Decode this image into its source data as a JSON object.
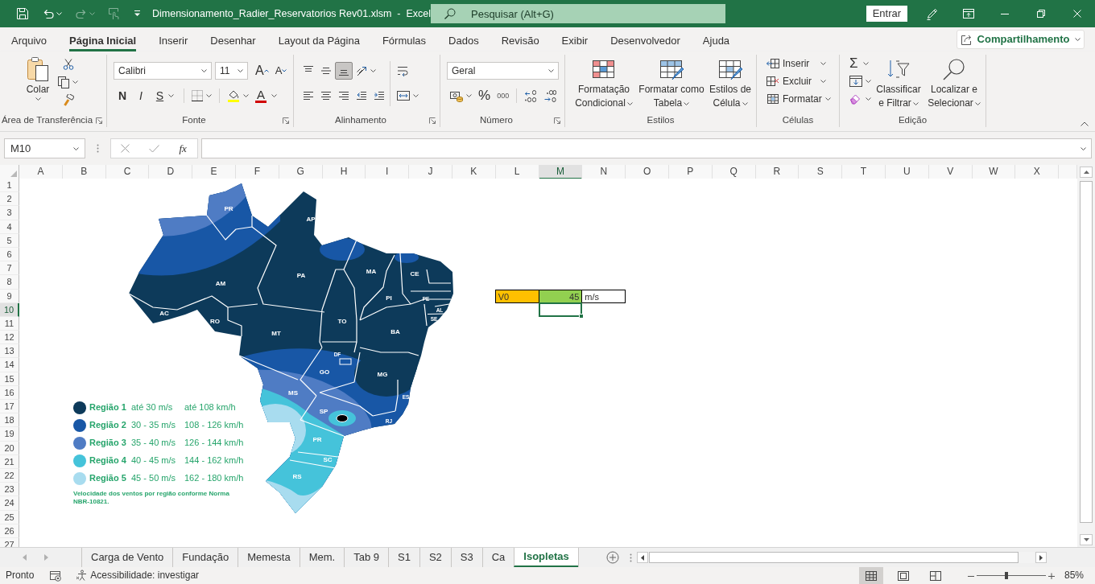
{
  "title_bar": {
    "title": "Dimensionamento_Radier_Reservatorios Rev01.xlsm  -  Excel",
    "search": {
      "placeholder": "Pesquisar (Alt+G)"
    },
    "sign_in": "Entrar"
  },
  "quick_access": [
    {
      "kind": "save",
      "disabled": false
    },
    {
      "kind": "undo",
      "disabled": false
    },
    {
      "kind": "redo",
      "disabled": true
    },
    {
      "kind": "touch",
      "disabled": true
    }
  ],
  "menu_tabs": [
    {
      "label": "Arquivo",
      "selected": false
    },
    {
      "label": "Página Inicial",
      "selected": true
    },
    {
      "label": "Inserir",
      "selected": false
    },
    {
      "label": "Desenhar",
      "selected": false
    },
    {
      "label": "Layout da Página",
      "selected": false
    },
    {
      "label": "Fórmulas",
      "selected": false
    },
    {
      "label": "Dados",
      "selected": false
    },
    {
      "label": "Revisão",
      "selected": false
    },
    {
      "label": "Exibir",
      "selected": false
    },
    {
      "label": "Desenvolvedor",
      "selected": false
    },
    {
      "label": "Ajuda",
      "selected": false
    }
  ],
  "share_button": "Compartilhamento",
  "ribbon": {
    "clipboard": {
      "label": "Área de Transferência",
      "paste": "Colar"
    },
    "font": {
      "label": "Fonte",
      "font_name": "Calibri",
      "font_size": "11",
      "grow": "A",
      "shrink": "A",
      "bold": "N",
      "italic": "I",
      "underline": "S",
      "font_color": "A"
    },
    "alignment": {
      "label": "Alinhamento",
      "vertical": [
        {
          "kind": "top",
          "selected": false
        },
        {
          "kind": "middle",
          "selected": false
        },
        {
          "kind": "bottom",
          "selected": true
        }
      ]
    },
    "number": {
      "label": "Número",
      "format": "Geral",
      "percent": "%",
      "thousands": "000"
    },
    "styles": {
      "label": "Estilos",
      "buttons": [
        {
          "kind": "conditional",
          "lines": [
            "Formatação",
            "Condicional"
          ]
        },
        {
          "kind": "table",
          "lines": [
            "Formatar como",
            "Tabela"
          ]
        },
        {
          "kind": "cell_styles",
          "lines": [
            "Estilos de",
            "Célula"
          ]
        }
      ]
    },
    "cells": {
      "label": "Células",
      "buttons": [
        {
          "kind": "insert",
          "label": "Inserir"
        },
        {
          "kind": "delete",
          "label": "Excluir"
        },
        {
          "kind": "format",
          "label": "Formatar"
        }
      ]
    },
    "editing": {
      "label": "Edição",
      "autosum": "Σ",
      "buttons": [
        {
          "kind": "sort",
          "lines": [
            "Classificar",
            "e Filtrar"
          ]
        },
        {
          "kind": "find",
          "lines": [
            "Localizar e",
            "Selecionar"
          ]
        }
      ]
    }
  },
  "formula_bar": {
    "name_box": "M10",
    "function_button": "fx"
  },
  "columns": [
    {
      "label": "A",
      "selected": false
    },
    {
      "label": "B",
      "selected": false
    },
    {
      "label": "C",
      "selected": false
    },
    {
      "label": "D",
      "selected": false
    },
    {
      "label": "E",
      "selected": false
    },
    {
      "label": "F",
      "selected": false
    },
    {
      "label": "G",
      "selected": false
    },
    {
      "label": "H",
      "selected": false
    },
    {
      "label": "I",
      "selected": false
    },
    {
      "label": "J",
      "selected": false
    },
    {
      "label": "K",
      "selected": false
    },
    {
      "label": "L",
      "selected": false
    },
    {
      "label": "M",
      "selected": true
    },
    {
      "label": "N",
      "selected": false
    },
    {
      "label": "O",
      "selected": false
    },
    {
      "label": "P",
      "selected": false
    },
    {
      "label": "Q",
      "selected": false
    },
    {
      "label": "R",
      "selected": false
    },
    {
      "label": "S",
      "selected": false
    },
    {
      "label": "T",
      "selected": false
    },
    {
      "label": "U",
      "selected": false
    },
    {
      "label": "V",
      "selected": false
    },
    {
      "label": "W",
      "selected": false
    },
    {
      "label": "X",
      "selected": false
    }
  ],
  "rows": [
    {
      "label": "1",
      "selected": false
    },
    {
      "label": "2",
      "selected": false
    },
    {
      "label": "3",
      "selected": false
    },
    {
      "label": "4",
      "selected": false
    },
    {
      "label": "5",
      "selected": false
    },
    {
      "label": "6",
      "selected": false
    },
    {
      "label": "7",
      "selected": false
    },
    {
      "label": "8",
      "selected": false
    },
    {
      "label": "9",
      "selected": false
    },
    {
      "label": "10",
      "selected": true
    },
    {
      "label": "11",
      "selected": false
    },
    {
      "label": "12",
      "selected": false
    },
    {
      "label": "13",
      "selected": false
    },
    {
      "label": "14",
      "selected": false
    },
    {
      "label": "15",
      "selected": false
    },
    {
      "label": "16",
      "selected": false
    },
    {
      "label": "17",
      "selected": false
    },
    {
      "label": "18",
      "selected": false
    },
    {
      "label": "19",
      "selected": false
    },
    {
      "label": "20",
      "selected": false
    },
    {
      "label": "21",
      "selected": false
    },
    {
      "label": "22",
      "selected": false
    },
    {
      "label": "23",
      "selected": false
    },
    {
      "label": "24",
      "selected": false
    },
    {
      "label": "25",
      "selected": false
    },
    {
      "label": "26",
      "selected": false
    },
    {
      "label": "27",
      "selected": false
    }
  ],
  "cells": [
    {
      "kind": "text",
      "value": "V0",
      "color": "#ffc000"
    },
    {
      "kind": "number",
      "value": "45",
      "color": "#92d050"
    },
    {
      "kind": "text",
      "value": "m/s"
    }
  ],
  "map": {
    "state_labels": [
      "PR",
      "AP",
      "AM",
      "PA",
      "MA",
      "CE",
      "PI",
      "PE",
      "AL",
      "SE",
      "AC",
      "RO",
      "MT",
      "TO",
      "BA",
      "DF",
      "GO",
      "MG",
      "ES",
      "MS",
      "SP",
      "RJ",
      "PR",
      "SC",
      "RS"
    ],
    "legend": [
      {
        "label": "Região 1",
        "speed_ms": "até 30 m/s",
        "speed_kmh": "até 108 km/h",
        "color": "#0d3a5a"
      },
      {
        "label": "Região 2",
        "speed_ms": "30 - 35 m/s",
        "speed_kmh": "108 - 126 km/h",
        "color": "#1857a6"
      },
      {
        "label": "Região 3",
        "speed_ms": "35 - 40 m/s",
        "speed_kmh": "126 - 144 km/h",
        "color": "#4f7cc4"
      },
      {
        "label": "Região 4",
        "speed_ms": "40 - 45 m/s",
        "speed_kmh": "144 - 162 km/h",
        "color": "#45c3da"
      },
      {
        "label": "Região 5",
        "speed_ms": "45 - 50 m/s",
        "speed_kmh": "162 - 180 km/h",
        "color": "#a8dcef"
      }
    ],
    "note": "Velocidade dos ventos por região conforme Norma NBR-10821."
  },
  "sheet_tabs": [
    {
      "label": "Carga de Vento",
      "selected": false
    },
    {
      "label": "Fundação",
      "selected": false
    },
    {
      "label": "Memesta",
      "selected": false
    },
    {
      "label": "Mem.",
      "selected": false
    },
    {
      "label": "Tab 9",
      "selected": false
    },
    {
      "label": "S1",
      "selected": false
    },
    {
      "label": "S2",
      "selected": false
    },
    {
      "label": "S3",
      "selected": false
    },
    {
      "label": "Ca",
      "selected": false
    },
    {
      "label": "Isopletas",
      "selected": true
    }
  ],
  "status_bar": {
    "status": "Pronto",
    "accessibility": "Acessibilidade: investigar",
    "views": [
      {
        "kind": "normal",
        "selected": true
      },
      {
        "kind": "page_layout",
        "selected": false
      },
      {
        "kind": "page_break",
        "selected": false
      }
    ],
    "zoom": {
      "level": 0.43,
      "reading": "85%"
    }
  }
}
